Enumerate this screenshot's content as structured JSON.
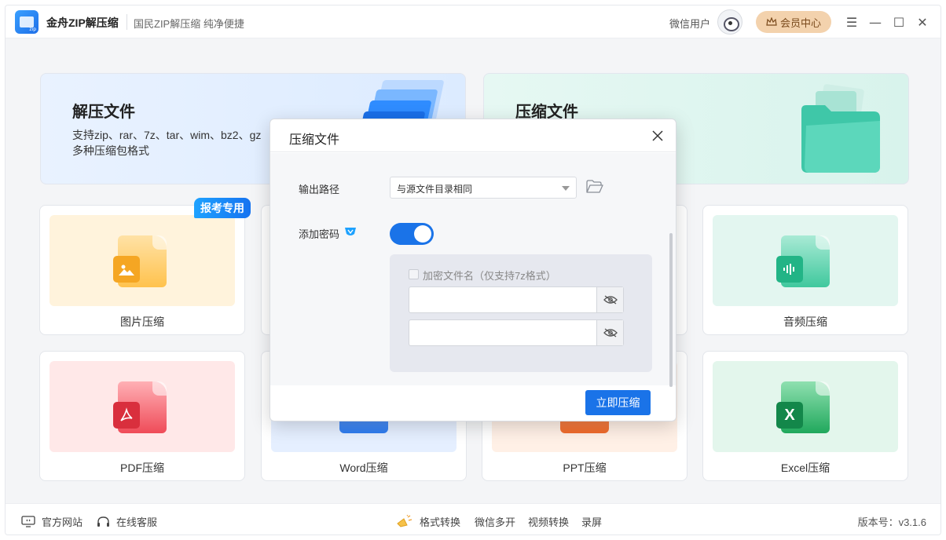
{
  "app": {
    "title": "金舟ZIP解压缩",
    "slogan": "国民ZIP解压缩  纯净便捷",
    "user_name": "微信用户",
    "vip_label": "会员中心"
  },
  "window_controls": {
    "menu": "☰",
    "minimize": "—",
    "maximize": "☐",
    "close": "✕"
  },
  "cards": {
    "unzip": {
      "title": "解压文件",
      "desc_line1": "支持zip、rar、7z、tar、wim、bz2、gz",
      "desc_line2": "多种压缩包格式"
    },
    "zip": {
      "title": "压缩文件"
    }
  },
  "features": {
    "badge": "报考专用",
    "image": "图片压缩",
    "audio": "音频压缩",
    "pdf": "PDF压缩",
    "word": "Word压缩",
    "ppt": "PPT压缩",
    "excel": "Excel压缩",
    "excel_glyph": "X"
  },
  "footer": {
    "website": "官方网站",
    "service": "在线客服",
    "format": "格式转换",
    "wechat": "微信多开",
    "video": "视频转换",
    "record": "录屏",
    "version": "版本号：v3.1.6"
  },
  "dialog": {
    "title": "压缩文件",
    "output_label": "输出路径",
    "output_value": "与源文件目录相同",
    "password_label": "添加密码",
    "password_enabled": true,
    "encrypt_name_label": "加密文件名（仅支持7z格式）",
    "encrypt_name_checked": false,
    "password_value": "",
    "confirm_value": "",
    "submit": "立即压缩"
  },
  "colors": {
    "primary": "#1a73e8",
    "vip_bg": "#f3d2ad",
    "badge": "#1e8cf5"
  }
}
